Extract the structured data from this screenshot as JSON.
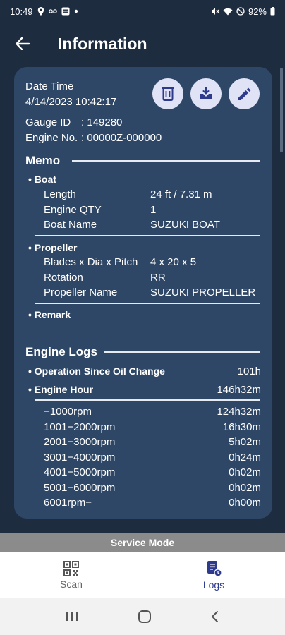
{
  "status_bar": {
    "time": "10:49",
    "battery": "92%",
    "icons": [
      "location-icon",
      "voicemail-icon",
      "screen-record-icon",
      "dot-icon",
      "mute-icon",
      "wifi-icon",
      "dnd-icon",
      "battery-icon"
    ]
  },
  "app_bar": {
    "title": "Information"
  },
  "info": {
    "date_time_label": "Date Time",
    "date_time_value": "4/14/2023 10:42:17",
    "gauge_id_label": "Gauge ID",
    "gauge_id_value": ": 149280",
    "engine_no_label": "Engine No.",
    "engine_no_value": ": 00000Z-000000"
  },
  "actions": [
    "delete-icon",
    "download-icon",
    "edit-icon"
  ],
  "memo": {
    "title": "Memo",
    "boat": {
      "heading": "• Boat",
      "rows": [
        {
          "label": "Length",
          "value": "24 ft / 7.31 m"
        },
        {
          "label": "Engine QTY",
          "value": "1"
        },
        {
          "label": "Boat Name",
          "value": "SUZUKI BOAT"
        }
      ]
    },
    "propeller": {
      "heading": "• Propeller",
      "rows": [
        {
          "label": "Blades x Dia x Pitch",
          "value": "4 x 20 x 5"
        },
        {
          "label": "Rotation",
          "value": "RR"
        },
        {
          "label": "Propeller Name",
          "value": "SUZUKI PROPELLER"
        }
      ]
    },
    "remark_heading": "• Remark"
  },
  "engine_logs": {
    "title": "Engine Logs",
    "oil_change_label": "• Operation Since Oil Change",
    "oil_change_value": "101h",
    "engine_hour_label": "• Engine Hour",
    "engine_hour_value": "146h32m",
    "rpm_rows": [
      {
        "label": "−1000rpm",
        "value": "124h32m"
      },
      {
        "label": "1001−2000rpm",
        "value": "16h30m"
      },
      {
        "label": "2001−3000rpm",
        "value": "5h02m"
      },
      {
        "label": "3001−4000rpm",
        "value": "0h24m"
      },
      {
        "label": "4001−5000rpm",
        "value": "0h02m"
      },
      {
        "label": "5001−6000rpm",
        "value": "0h02m"
      },
      {
        "label": "6001rpm−",
        "value": "0h00m"
      }
    ]
  },
  "service_mode": "Service Mode",
  "bottom_nav": {
    "scan_label": "Scan",
    "logs_label": "Logs",
    "active": "Logs",
    "active_color": "#2e3a8c",
    "inactive_color": "#666666"
  },
  "colors": {
    "background": "#1e2c40",
    "card": "#2f4766",
    "button": "#dfe3f5",
    "button_icon": "#2e3a8c"
  }
}
